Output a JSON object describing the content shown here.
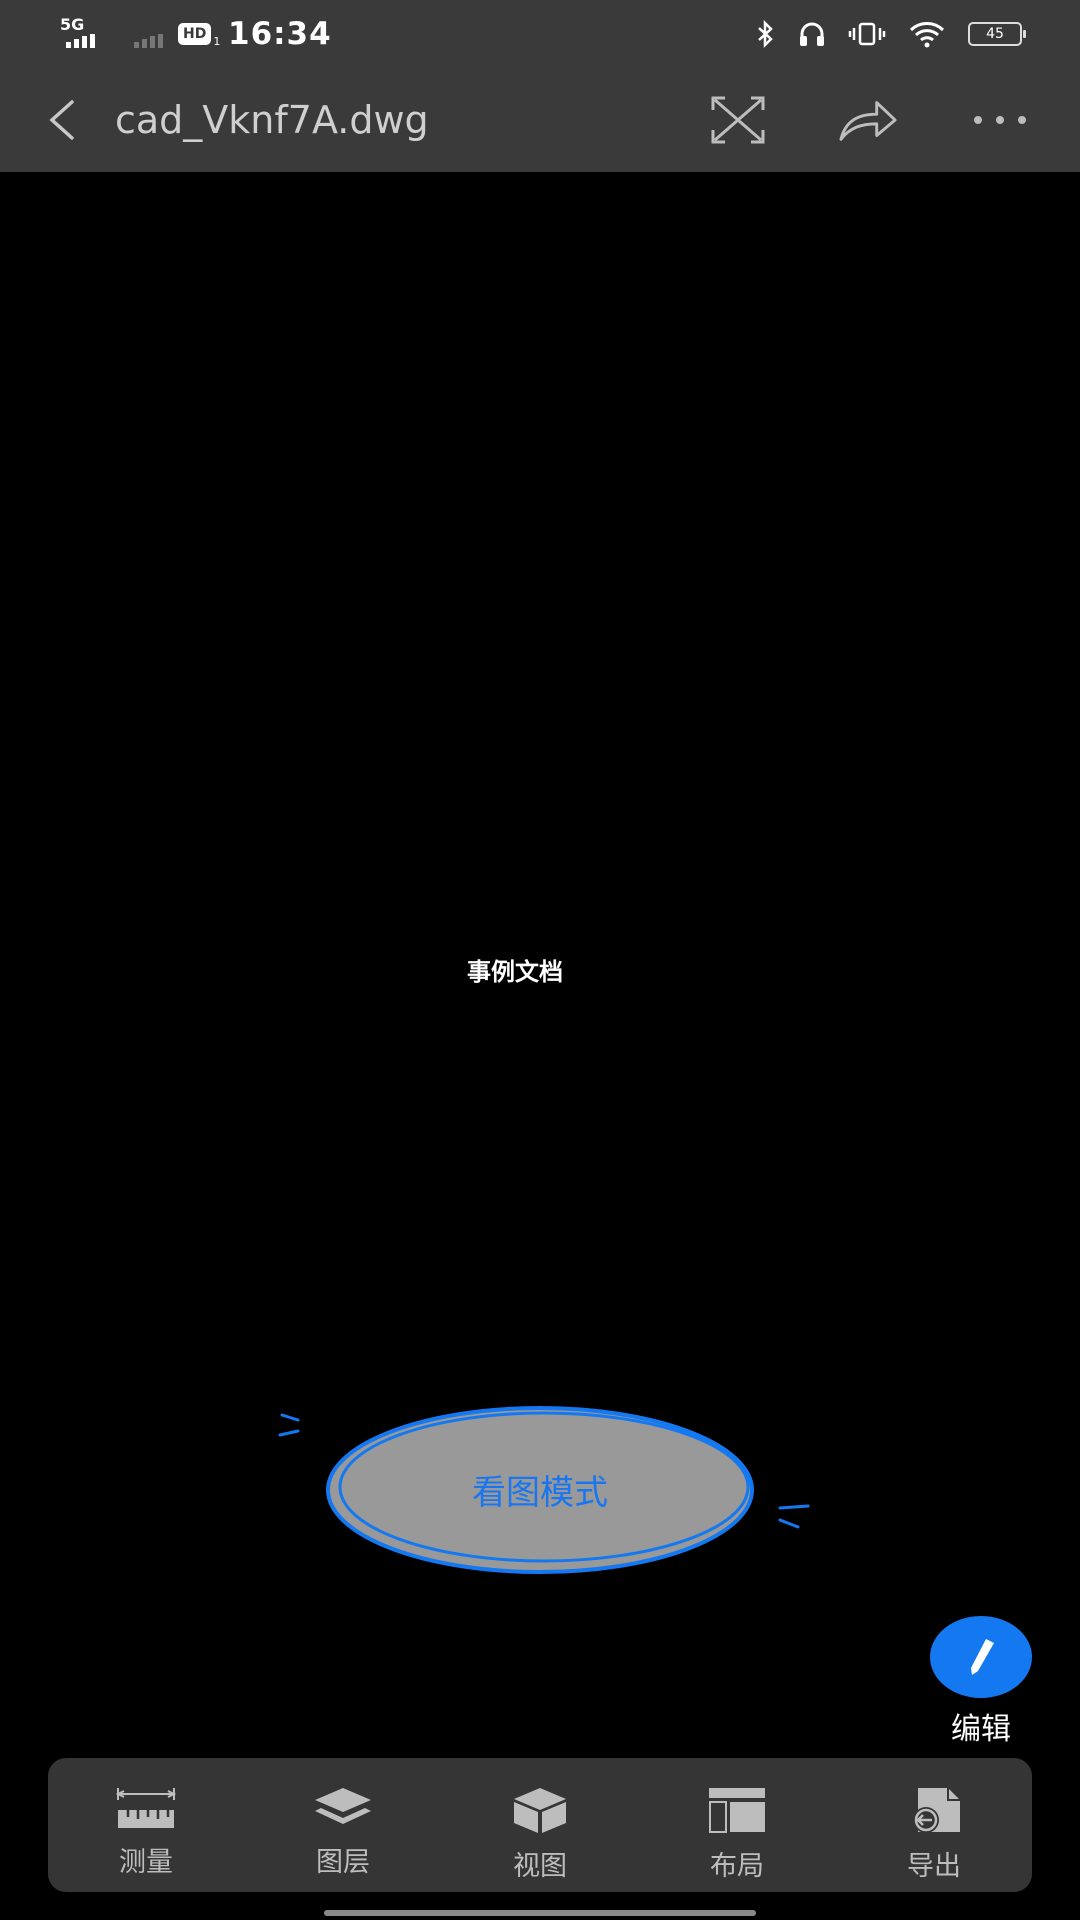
{
  "status_bar": {
    "network": "5G",
    "hd": "HD",
    "hd_sub": "1",
    "time": "16:34",
    "battery": "45"
  },
  "header": {
    "title": "cad_Vknf7A.dwg"
  },
  "canvas": {
    "document_text": "事例文档",
    "mode_label": "看图模式"
  },
  "fab": {
    "label": "编辑"
  },
  "toolbar": {
    "items": [
      {
        "label": "测量",
        "icon": "ruler-icon"
      },
      {
        "label": "图层",
        "icon": "layers-icon"
      },
      {
        "label": "视图",
        "icon": "cube-icon"
      },
      {
        "label": "布局",
        "icon": "layout-icon"
      },
      {
        "label": "导出",
        "icon": "export-icon"
      }
    ]
  },
  "colors": {
    "accent": "#1478f0",
    "bar_bg": "#3a3a3a",
    "toolbar_bg": "#353535"
  }
}
